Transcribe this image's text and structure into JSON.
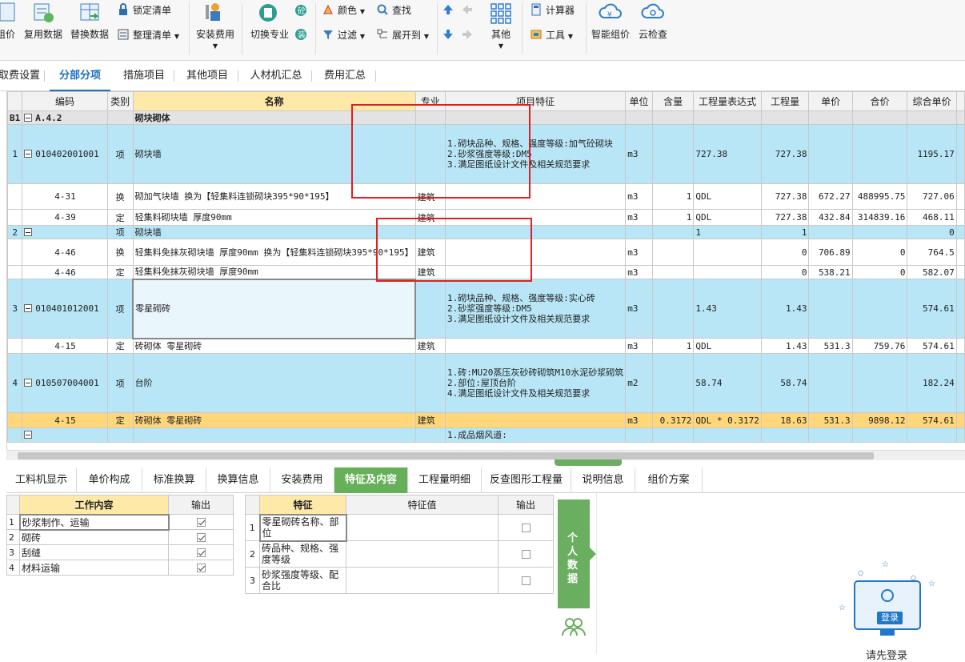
{
  "toolbar": {
    "big": [
      {
        "label": "组价",
        "icon": "price-group-icon"
      },
      {
        "label": "复用数据",
        "icon": "reuse-data-icon"
      },
      {
        "label": "替换数据",
        "icon": "replace-data-icon"
      },
      {
        "label": "安装费用",
        "icon": "install-fee-icon"
      },
      {
        "label": "切换专业",
        "icon": "switch-major-icon"
      },
      {
        "label": "其他",
        "icon": "other-grid-icon"
      },
      {
        "label": "智能组价",
        "icon": "smart-price-icon"
      },
      {
        "label": "云检查",
        "icon": "cloud-check-icon"
      }
    ],
    "small": [
      {
        "label": "锁定清单",
        "icon": "lock-icon"
      },
      {
        "label": "整理清单",
        "icon": "organize-list-icon"
      },
      {
        "label": "颜色",
        "icon": "color-icon"
      },
      {
        "label": "查找",
        "icon": "search-icon"
      },
      {
        "label": "过滤",
        "icon": "filter-icon"
      },
      {
        "label": "展开到",
        "icon": "expand-icon"
      },
      {
        "label": "计算器",
        "icon": "calculator-icon"
      },
      {
        "label": "工具",
        "icon": "tools-icon"
      }
    ]
  },
  "tabs": [
    "取费设置",
    "分部分项",
    "措施项目",
    "其他项目",
    "人材机汇总",
    "费用汇总"
  ],
  "grid": {
    "headers": [
      "编码",
      "类别",
      "名称",
      "专业",
      "项目特征",
      "单位",
      "含量",
      "工程量表达式",
      "工程量",
      "单价",
      "合价",
      "综合单价"
    ],
    "rows": [
      {
        "idx": "B1",
        "code": "A.4.2",
        "type": "",
        "name": "砌块砌体",
        "major": "",
        "feature": "",
        "unit": "",
        "qty_ratio": "",
        "expr": "",
        "qty": "",
        "price": "",
        "total": "",
        "comp": "",
        "style": "g"
      },
      {
        "idx": "1",
        "code": "010402001001",
        "type": "项",
        "name": "砌块墙",
        "major": "",
        "feature": "1.砌块品种、规格、强度等级:加气砼砌块\n2.砂浆强度等级:DM5\n3.满足图纸设计文件及相关规范要求",
        "unit": "m3",
        "qty_ratio": "",
        "expr": "727.38",
        "qty": "727.38",
        "price": "",
        "total": "",
        "comp": "1195.17",
        "style": "q"
      },
      {
        "idx": "",
        "code": "4-31",
        "type": "换",
        "name": "砌加气块墙  换为【轻集料连锁砌块395*90*195】",
        "major": "建筑",
        "feature": "",
        "unit": "m3",
        "qty_ratio": "1",
        "expr": "QDL",
        "qty": "727.38",
        "price": "672.27",
        "total": "488995.75",
        "comp": "727.06",
        "style": "b"
      },
      {
        "idx": "",
        "code": "4-39",
        "type": "定",
        "name": "轻集料砌块墙 厚度90mm",
        "major": "建筑",
        "feature": "",
        "unit": "m3",
        "qty_ratio": "1",
        "expr": "QDL",
        "qty": "727.38",
        "price": "432.84",
        "total": "314839.16",
        "comp": "468.11",
        "style": "b"
      },
      {
        "idx": "2",
        "code": "",
        "type": "项",
        "name": "砌块墙",
        "major": "",
        "feature": "",
        "unit": "",
        "qty_ratio": "",
        "expr": "1",
        "qty": "1",
        "price": "",
        "total": "",
        "comp": "0",
        "style": "q"
      },
      {
        "idx": "",
        "code": "4-46",
        "type": "换",
        "name": "轻集料免抹灰砌块墙 厚度90mm  换为【轻集料连锁砌块395*90*195】",
        "major": "建筑",
        "feature": "",
        "unit": "m3",
        "qty_ratio": "",
        "expr": "",
        "qty": "0",
        "price": "706.89",
        "total": "0",
        "comp": "764.5",
        "style": "b"
      },
      {
        "idx": "",
        "code": "4-46",
        "type": "定",
        "name": "轻集料免抹灰砌块墙 厚度90mm",
        "major": "建筑",
        "feature": "",
        "unit": "m3",
        "qty_ratio": "",
        "expr": "",
        "qty": "0",
        "price": "538.21",
        "total": "0",
        "comp": "582.07",
        "style": "b"
      },
      {
        "idx": "3",
        "code": "010401012001",
        "type": "项",
        "name": "零星砌砖",
        "major": "",
        "feature": "1.砌块品种、规格、强度等级:实心砖\n2.砂浆强度等级:DM5\n3.满足图纸设计文件及相关规范要求",
        "unit": "m3",
        "qty_ratio": "",
        "expr": "1.43",
        "qty": "1.43",
        "price": "",
        "total": "",
        "comp": "574.61",
        "style": "q"
      },
      {
        "idx": "",
        "code": "4-15",
        "type": "定",
        "name": "砖砌体 零星砌砖",
        "major": "建筑",
        "feature": "",
        "unit": "m3",
        "qty_ratio": "1",
        "expr": "QDL",
        "qty": "1.43",
        "price": "531.3",
        "total": "759.76",
        "comp": "574.61",
        "style": "b"
      },
      {
        "idx": "4",
        "code": "010507004001",
        "type": "项",
        "name": "台阶",
        "major": "",
        "feature": "1.砖:MU20蒸压灰砂砖砌筑M10水泥砂浆砌筑\n2.部位:屋顶台阶\n4.满足图纸设计文件及相关规范要求",
        "unit": "m2",
        "qty_ratio": "",
        "expr": "58.74",
        "qty": "58.74",
        "price": "",
        "total": "",
        "comp": "182.24",
        "style": "q"
      },
      {
        "idx": "",
        "code": "4-15",
        "type": "定",
        "name": "砖砌体 零星砌砖",
        "major": "建筑",
        "feature": "",
        "unit": "m3",
        "qty_ratio": "0.3172",
        "expr": "QDL * 0.3172",
        "qty": "18.63",
        "price": "531.3",
        "total": "9898.12",
        "comp": "574.61",
        "style": "y"
      },
      {
        "idx": "",
        "code": "",
        "type": "",
        "name": "",
        "major": "",
        "feature": "1.成品烟风道:",
        "unit": "",
        "qty_ratio": "",
        "expr": "",
        "qty": "",
        "price": "",
        "total": "",
        "comp": "",
        "style": "q"
      }
    ]
  },
  "bottom_tabs": [
    "工料机显示",
    "单价构成",
    "标准换算",
    "换算信息",
    "安装费用",
    "特征及内容",
    "工程量明细",
    "反查图形工程量",
    "说明信息",
    "组价方案"
  ],
  "work_table": {
    "headers": [
      "工作内容",
      "输出"
    ],
    "rows": [
      {
        "idx": "1",
        "name": "砂浆制作、运输",
        "checked": true
      },
      {
        "idx": "2",
        "name": "砌砖",
        "checked": true
      },
      {
        "idx": "3",
        "name": "刮缝",
        "checked": true
      },
      {
        "idx": "4",
        "name": "材料运输",
        "checked": true
      }
    ]
  },
  "feature_table": {
    "headers": [
      "特征",
      "特征值",
      "输出"
    ],
    "rows": [
      {
        "idx": "1",
        "name": "零星砌砖名称、部位",
        "value": "",
        "checked": false
      },
      {
        "idx": "2",
        "name": "砖品种、规格、强度等级",
        "value": "",
        "checked": false
      },
      {
        "idx": "3",
        "name": "砂浆强度等级、配合比",
        "value": "",
        "checked": false
      }
    ]
  },
  "side_panel": {
    "label": "个人数据"
  },
  "login": {
    "button": "登录",
    "text": "请先登录"
  }
}
